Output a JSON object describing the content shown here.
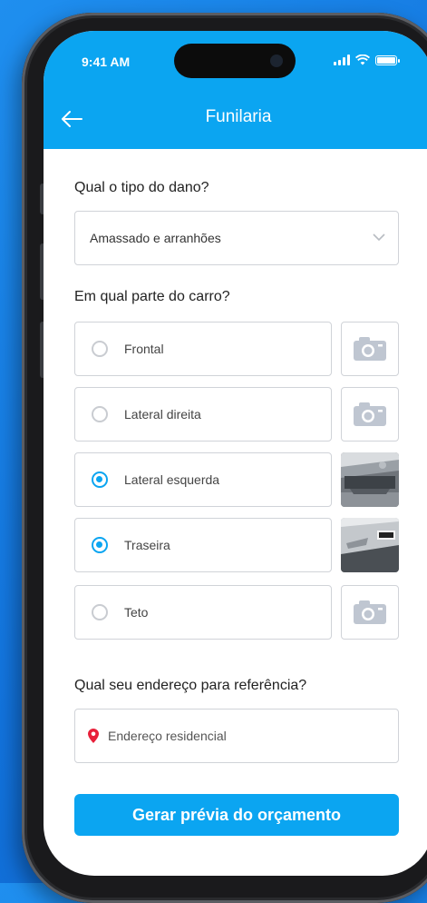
{
  "status": {
    "time": "9:41 AM"
  },
  "header": {
    "title": "Funilaria",
    "back_icon": "arrow-left-icon"
  },
  "damage": {
    "question": "Qual o tipo do dano?",
    "selected": "Amassado e arranhões"
  },
  "parts": {
    "question": "Em qual parte do carro?",
    "options": [
      {
        "label": "Frontal",
        "selected": false,
        "photo": "camera-icon"
      },
      {
        "label": "Lateral direita",
        "selected": false,
        "photo": "camera-icon"
      },
      {
        "label": "Lateral esquerda",
        "selected": true,
        "photo": "car-side-photo"
      },
      {
        "label": "Traseira",
        "selected": true,
        "photo": "car-rear-photo"
      },
      {
        "label": "Teto",
        "selected": false,
        "photo": "camera-icon"
      }
    ]
  },
  "address": {
    "question": "Qual seu endereço para referência?",
    "placeholder": "Endereço residencial"
  },
  "cta": {
    "label": "Gerar prévia do orçamento"
  },
  "colors": {
    "primary": "#0ba5f1",
    "background": "#1273dd",
    "pin": "#e8203a"
  }
}
